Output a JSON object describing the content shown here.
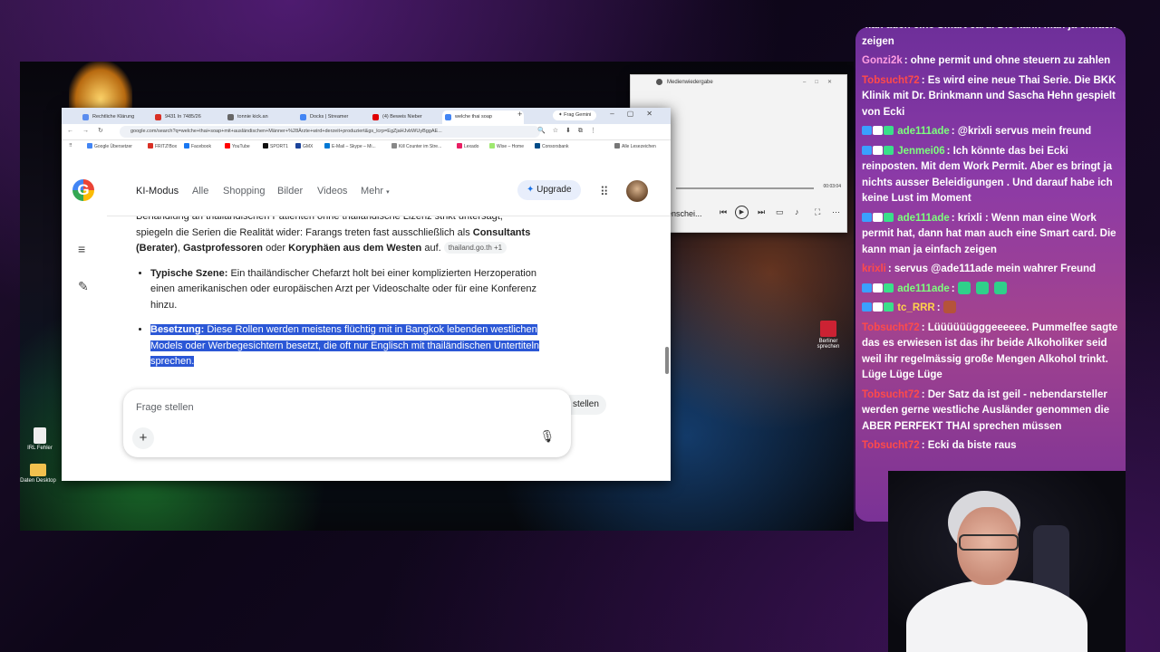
{
  "browser": {
    "tabs": [
      {
        "label": "Rechtliche Klärung",
        "color": "#5b8def"
      },
      {
        "label": "9431 In 7485/26",
        "color": "#d93025"
      },
      {
        "label": "tonnie kick.an",
        "color": "#666666"
      },
      {
        "label": "Docks | Streamer",
        "color": "#4285f4"
      },
      {
        "label": "(4) Beweis Nieber",
        "color": "#e00000"
      },
      {
        "label": "welche thai soap",
        "color": "#4285f4"
      }
    ],
    "new_tab": "+",
    "gemini_label": "Frag Gemini",
    "url": "google.com/search?q=welche+thai+soap+mit+ausländischen+Männer+%28Ärzte+wird+derzeit+produziert&gs_lcrp=EgZjaHJvbWUyBggAE...",
    "bookmarks": [
      {
        "label": "Google Übersetzer",
        "color": "#4285f4"
      },
      {
        "label": "FRITZ!Box",
        "color": "#d93025"
      },
      {
        "label": "Facebook",
        "color": "#1877f2"
      },
      {
        "label": "YouTube",
        "color": "#ff0000"
      },
      {
        "label": "SPORT1",
        "color": "#111111"
      },
      {
        "label": "GMX",
        "color": "#1c449b"
      },
      {
        "label": "E-Mail – Skype – Mi...",
        "color": "#0078d4"
      },
      {
        "label": "Kill Counter im Stre...",
        "color": "#888888"
      },
      {
        "label": "Lexado",
        "color": "#e91e63"
      },
      {
        "label": "Wise – Home",
        "color": "#9fe870"
      },
      {
        "label": "Consorsbank",
        "color": "#004b87"
      }
    ],
    "all_bookmarks": "Alle Lesezeichen"
  },
  "google": {
    "nav": [
      "KI-Modus",
      "Alle",
      "Shopping",
      "Bilder",
      "Videos",
      "Mehr"
    ],
    "upgrade": "Upgrade",
    "paragraph_top": "Behandlung an thailändischen Patienten ohne thailändische Lizenz strikt untersagt,",
    "paragraph_line2_pre": "spiegeln die Serien die Realität wider: Farangs treten fast ausschließlich als ",
    "consultants": "Consultants",
    "berater": "(Berater)",
    "gastprofessoren": "Gastprofessoren",
    "oder": " oder ",
    "koryphaeen": "Koryphäen aus dem Westen",
    "auf": " auf.",
    "source_chip": "thailand.go.th  +1",
    "bullet1_title": "Typische Szene:",
    "bullet1_text": " Ein thailändischer Chefarzt holt bei einer komplizierten Herzoperation einen amerikanischen oder europäischen Arzt per Videoschalte oder für eine Konferenz hinzu.",
    "bullet2_title": "Besetzung:",
    "bullet2_text": " Diese Rollen werden meistens flüchtig mit in Bangkok lebenden westlichen Models oder Werbegesichtern besetzt, die oft nur Englisch mit thailändischen Untertiteln sprechen.",
    "ask_placeholder": "Frage stellen",
    "stellen_partial": "stellen"
  },
  "media_player": {
    "title": "Medienwiedergabe",
    "time": "00:03:04",
    "current_label": "enschei..."
  },
  "desktop_icons": [
    {
      "label": "IRL Fehler"
    },
    {
      "label": "Daten Desktop"
    },
    {
      "label": "Berliner sprechen"
    }
  ],
  "chat": [
    {
      "user": "",
      "user_color": "#ffffff",
      "text": "man auch eine Smart card. Die kann man ja einfach zeigen",
      "badges": false
    },
    {
      "user": "Gonzi2k",
      "user_color": "#ff9de2",
      "text": ": ohne permit und ohne steuern zu zahlen",
      "badges": false
    },
    {
      "user": "Tobsucht72",
      "user_color": "#ff4a4a",
      "text": ": Es wird eine neue Thai Serie. Die BKK Klinik mit Dr. Brinkmann und Sascha Hehn gespielt von Ecki",
      "badges": false
    },
    {
      "user": "ade111ade",
      "user_color": "#7dff7d",
      "text": ": @krixli servus mein freund",
      "badges": true
    },
    {
      "user": "Jenmei06",
      "user_color": "#7dff7d",
      "text": ": Ich könnte das bei Ecki reinposten. Mit dem Work Permit. Aber es bringt ja nichts ausser Beleidigungen . Und darauf habe ich keine Lust im Moment",
      "badges": true
    },
    {
      "user": "ade111ade",
      "user_color": "#7dff7d",
      "text": ": krixli : Wenn man eine Work permit hat, dann hat man auch eine Smart card. Die kann man ja einfach zeigen",
      "badges": true
    },
    {
      "user": "krixli",
      "user_color": "#ff4a4a",
      "text": ": servus @ade111ade mein wahrer Freund",
      "badges": false
    },
    {
      "user": "ade111ade",
      "user_color": "#7dff7d",
      "text": ":",
      "badges": true,
      "emotes": 3
    },
    {
      "user": "tc_RRR",
      "user_color": "#ffd34a",
      "text": ":",
      "badges": true,
      "emotes": 1
    },
    {
      "user": "Tobsucht72",
      "user_color": "#ff4a4a",
      "text": ": Lüüüüüügggeeeeee. Pummelfee sagte das es erwiesen ist das ihr beide Alkoholiker seid weil ihr regelmässig große Mengen Alkohol trinkt. Lüge Lüge Lüge",
      "badges": false
    },
    {
      "user": "Tobsucht72",
      "user_color": "#ff4a4a",
      "text": ": Der Satz da ist geil - nebendarsteller werden gerne westliche Ausländer genommen die ABER PERFEKT THAI sprechen müssen",
      "badges": false
    },
    {
      "user": "Tobsucht72",
      "user_color": "#ff4a4a",
      "text": ": Ecki da biste raus",
      "badges": false
    }
  ]
}
